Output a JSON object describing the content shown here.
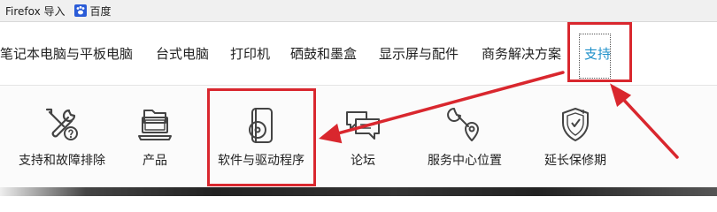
{
  "bookmarks": [
    {
      "label": "Firefox 导入",
      "icon": "folder-icon"
    },
    {
      "label": "百度",
      "icon": "paw-icon"
    }
  ],
  "nav": {
    "items": [
      "笔记本电脑与平板电脑",
      "台式电脑",
      "打印机",
      "硒鼓和墨盒",
      "显示屏与配件",
      "商务解决方案",
      "支持"
    ],
    "active_index": 6
  },
  "submenu": {
    "items": [
      {
        "label": "支持和故障排除",
        "icon": "tools-question-icon"
      },
      {
        "label": "产品",
        "icon": "folder-computer-icon"
      },
      {
        "label": "软件与驱动程序",
        "icon": "software-disc-icon"
      },
      {
        "label": "论坛",
        "icon": "chat-bubbles-icon"
      },
      {
        "label": "服务中心位置",
        "icon": "wrench-location-icon"
      },
      {
        "label": "延长保修期",
        "icon": "shield-check-icon"
      }
    ]
  },
  "colors": {
    "active_nav": "#1e90c9",
    "annotation_red": "#d9272e"
  }
}
